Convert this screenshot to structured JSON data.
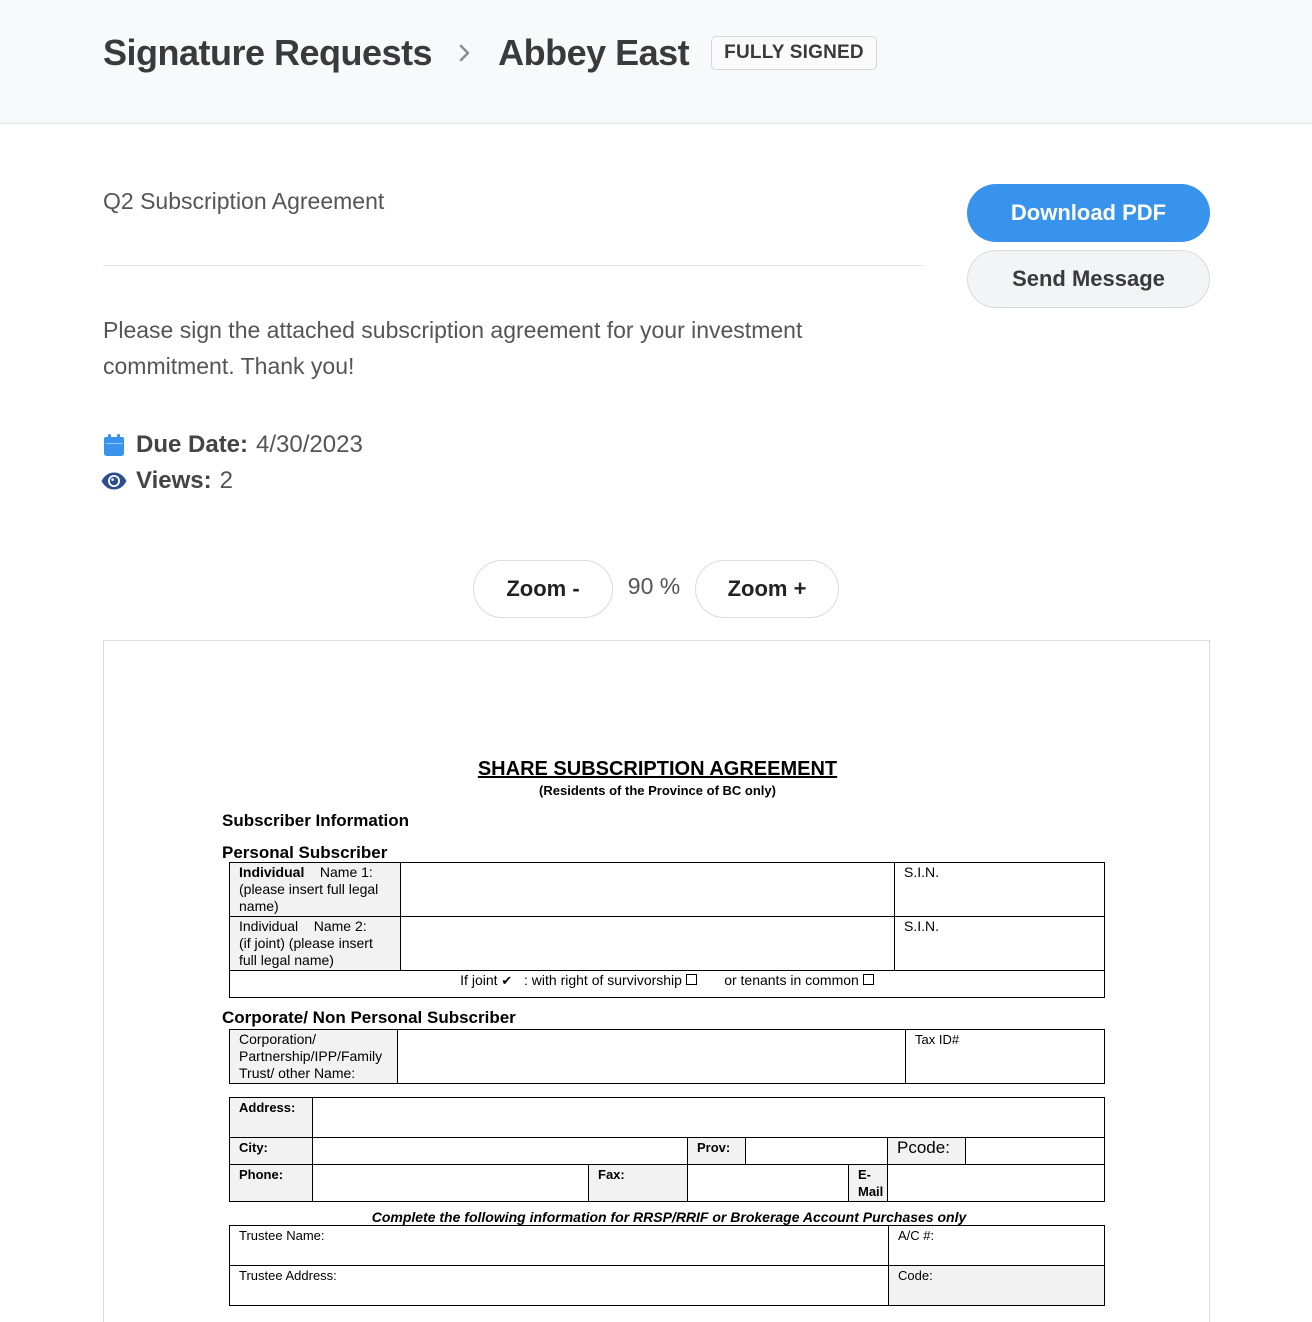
{
  "header": {
    "breadcrumb_root": "Signature Requests",
    "breadcrumb_current": "Abbey East",
    "status_badge": "FULLY SIGNED"
  },
  "request": {
    "document_title": "Q2 Subscription Agreement",
    "message": "Please sign the attached subscription agreement for your investment commitment. Thank you!",
    "due_date_label": "Due Date:",
    "due_date_value": "4/30/2023",
    "views_label": "Views:",
    "views_value": "2"
  },
  "actions": {
    "download_label": "Download PDF",
    "send_message_label": "Send Message"
  },
  "viewer": {
    "zoom_out_label": "Zoom -",
    "zoom_in_label": "Zoom +",
    "zoom_level": "90 %"
  },
  "pdf": {
    "title": "SHARE SUBSCRIPTION AGREEMENT",
    "subtitle": "(Residents of the Province of BC only)",
    "subscriber_info_heading": "Subscriber Information",
    "personal_heading": "Personal Subscriber",
    "individual_label": "Individual",
    "name1_label": "Name 1:",
    "name1_hint": "(please insert full legal name)",
    "individual2_label": "Individual",
    "name2_label": "Name 2:",
    "name2_hint": "(if joint) (please insert full legal name)",
    "sin_label": "S.I.N.",
    "joint_prefix": "If joint",
    "joint_check": "✔",
    "joint_survivorship": ": with right of survivorship",
    "joint_tenants": "or tenants in common",
    "corporate_heading": "Corporate/ Non Personal Subscriber",
    "corporate_label": "Corporation/ Partnership/IPP/Family Trust/ other Name:",
    "tax_id_label": "Tax ID#",
    "address_label": "Address:",
    "city_label": "City:",
    "prov_label": "Prov:",
    "pcode_label": "Pcode:",
    "phone_label": "Phone:",
    "fax_label": "Fax:",
    "email_label": "E-Mail",
    "rrsp_note": "Complete the following information for RRSP/RRIF or Brokerage Account Purchases only",
    "trustee_name_label": "Trustee Name:",
    "ac_label": "A/C #:",
    "trustee_address_label": "Trustee Address:",
    "code_label": "Code:"
  },
  "colors": {
    "primary": "#3793ec",
    "header_bg": "#f8f9fb",
    "calendar_icon": "#3793ec",
    "eye_icon": "#2a4f8f"
  }
}
